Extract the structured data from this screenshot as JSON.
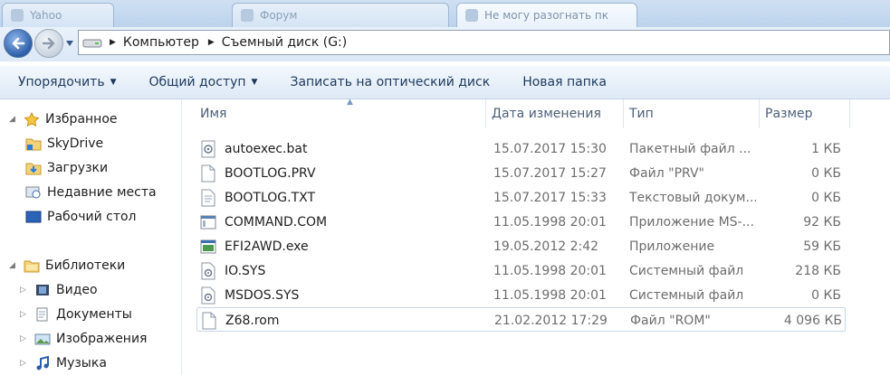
{
  "tabs": [
    {
      "label": "Yahoo"
    },
    {
      "label": "Форум"
    },
    {
      "label": "Не могу разогнать пк"
    }
  ],
  "address": {
    "crumbs": [
      "Компьютер",
      "Съемный диск (G:)"
    ]
  },
  "toolbar": {
    "organize": "Упорядочить",
    "share": "Общий доступ",
    "burn": "Записать на оптический диск",
    "new_folder": "Новая папка"
  },
  "nav": {
    "favorites": "Избранное",
    "skydrive": "SkyDrive",
    "downloads": "Загрузки",
    "recent": "Недавние места",
    "desktop": "Рабочий стол",
    "libraries": "Библиотеки",
    "video": "Видео",
    "documents": "Документы",
    "pictures": "Изображения",
    "music": "Музыка"
  },
  "columns": {
    "name": "Имя",
    "date": "Дата изменения",
    "type": "Тип",
    "size": "Размер"
  },
  "files": [
    {
      "name": "autoexec.bat",
      "date": "15.07.2017 15:30",
      "type": "Пакетный файл ...",
      "size": "1 КБ",
      "icon": "batch-file-icon"
    },
    {
      "name": "BOOTLOG.PRV",
      "date": "15.07.2017 15:27",
      "type": "Файл \"PRV\"",
      "size": "0 КБ",
      "icon": "file-icon"
    },
    {
      "name": "BOOTLOG.TXT",
      "date": "15.07.2017 15:33",
      "type": "Текстовый докум...",
      "size": "0 КБ",
      "icon": "text-file-icon"
    },
    {
      "name": "COMMAND.COM",
      "date": "11.05.1998 20:01",
      "type": "Приложение MS-...",
      "size": "92 КБ",
      "icon": "app-icon"
    },
    {
      "name": "EFI2AWD.exe",
      "date": "19.05.2012 2:42",
      "type": "Приложение",
      "size": "59 КБ",
      "icon": "exe-icon"
    },
    {
      "name": "IO.SYS",
      "date": "11.05.1998 20:01",
      "type": "Системный файл",
      "size": "218 КБ",
      "icon": "system-file-icon"
    },
    {
      "name": "MSDOS.SYS",
      "date": "11.05.1998 20:01",
      "type": "Системный файл",
      "size": "0 КБ",
      "icon": "system-file-icon"
    },
    {
      "name": "Z68.rom",
      "date": "21.02.2012 17:29",
      "type": "Файл \"ROM\"",
      "size": "4 096 КБ",
      "icon": "file-icon"
    }
  ]
}
